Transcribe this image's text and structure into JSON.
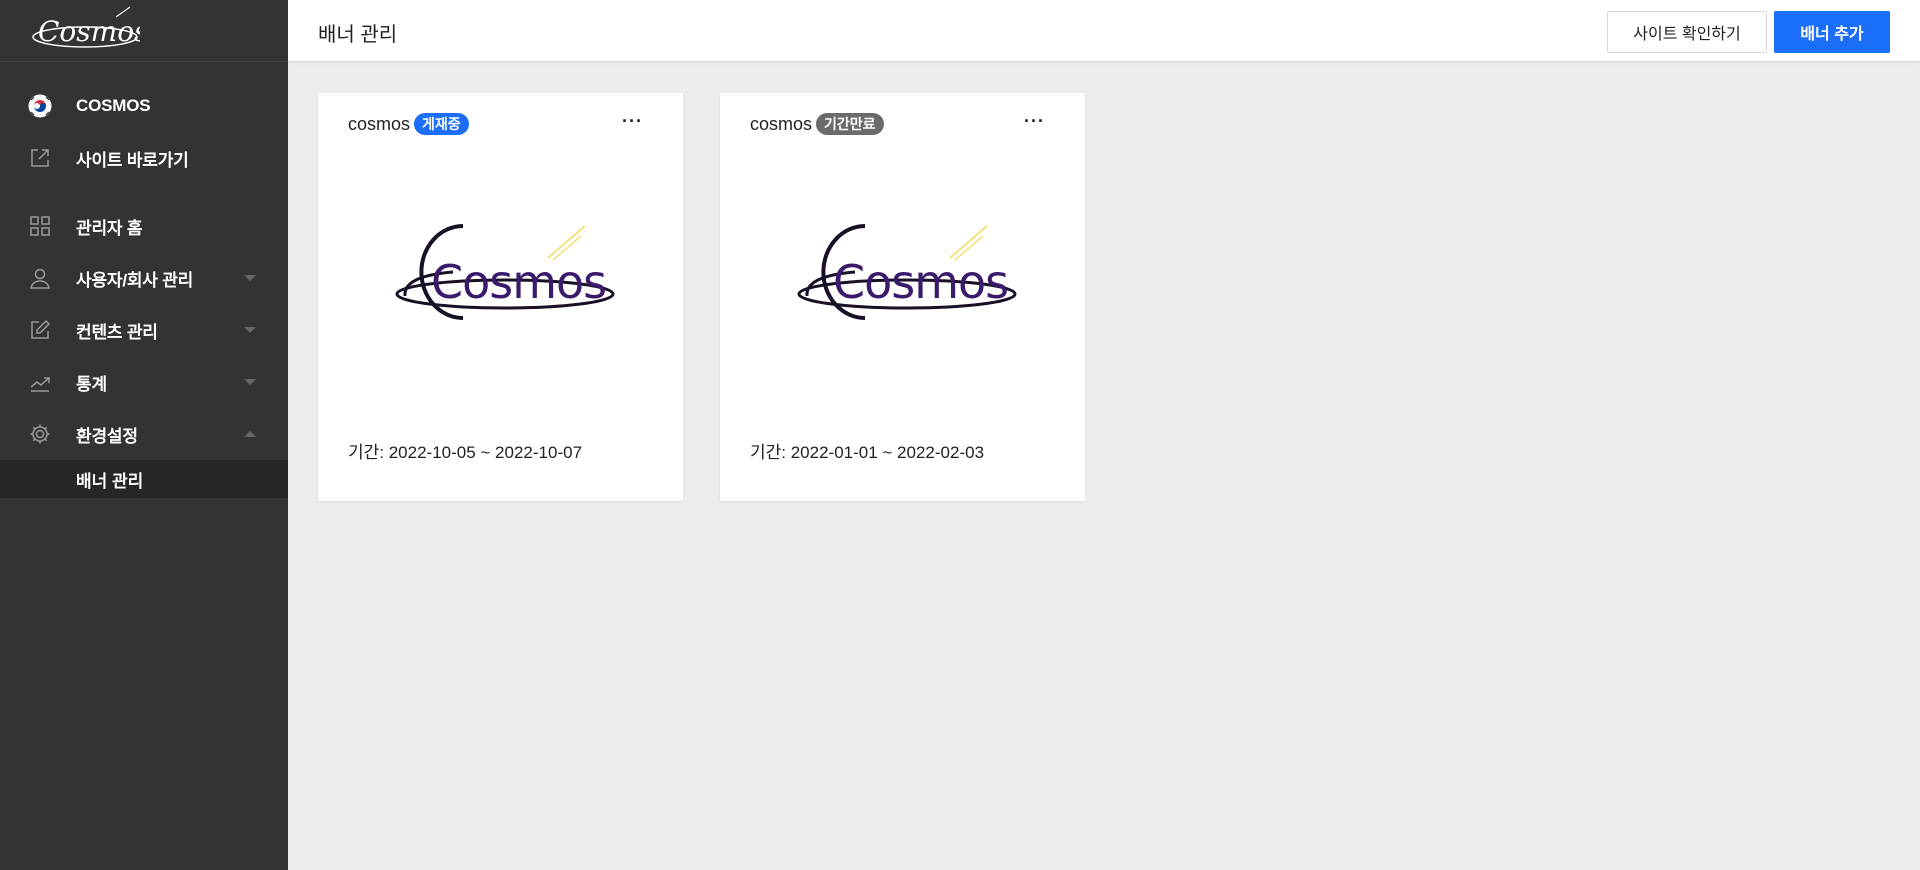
{
  "app": {
    "logo_text": "Cosmos"
  },
  "sidebar": {
    "items": [
      {
        "label": "COSMOS",
        "icon": "korea-flag-icon"
      },
      {
        "label": "사이트 바로가기",
        "icon": "external-link-icon"
      },
      {
        "label": "관리자 홈",
        "icon": "grid-icon"
      },
      {
        "label": "사용자/회사 관리",
        "icon": "user-icon",
        "caret": "down"
      },
      {
        "label": "컨텐츠 관리",
        "icon": "edit-icon",
        "caret": "down"
      },
      {
        "label": "통계",
        "icon": "chart-line-icon",
        "caret": "down"
      },
      {
        "label": "환경설정",
        "icon": "gear-icon",
        "caret": "up"
      }
    ],
    "sub_items": [
      {
        "label": "배너 관리",
        "active": true
      }
    ]
  },
  "header": {
    "title": "배너 관리",
    "site_button": "사이트 확인하기",
    "add_button": "배너 추가"
  },
  "banners": [
    {
      "name": "cosmos",
      "status": "게재중",
      "status_color": "#1a6ef7",
      "period": "기간: 2022-10-05 ~ 2022-10-07",
      "more": "···",
      "image_text": "Cosmos"
    },
    {
      "name": "cosmos",
      "status": "기간만료",
      "status_color": "#6b6b6b",
      "period": "기간: 2022-01-01 ~ 2022-02-03",
      "more": "···",
      "image_text": "Cosmos"
    }
  ],
  "colors": {
    "sidebar_bg": "#333333",
    "primary": "#1a6ef7",
    "content_bg": "#ededed"
  }
}
